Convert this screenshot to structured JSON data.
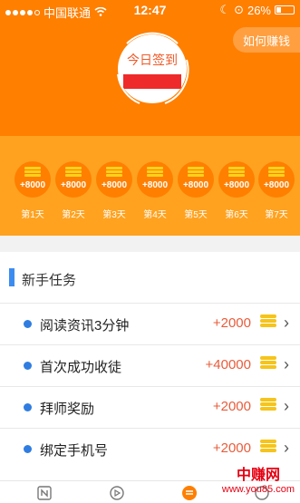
{
  "status_bar": {
    "carrier": "中国联通",
    "time": "12:47",
    "battery": "26%"
  },
  "header": {
    "how_earn_label": "如何赚钱",
    "signin_label": "今日签到",
    "accent_color": "#ff7f00"
  },
  "days": [
    {
      "label": "第1天",
      "reward": "+8000"
    },
    {
      "label": "第2天",
      "reward": "+8000"
    },
    {
      "label": "第3天",
      "reward": "+8000"
    },
    {
      "label": "第4天",
      "reward": "+8000"
    },
    {
      "label": "第5天",
      "reward": "+8000"
    },
    {
      "label": "第6天",
      "reward": "+8000"
    },
    {
      "label": "第7天",
      "reward": "+8000"
    }
  ],
  "tasks": {
    "title": "新手任务",
    "items": [
      {
        "name": "阅读资讯3分钟",
        "reward": "+2000"
      },
      {
        "name": "首次成功收徒",
        "reward": "+40000"
      },
      {
        "name": "拜师奖励",
        "reward": "+2000"
      },
      {
        "name": "绑定手机号",
        "reward": "+2000"
      }
    ]
  },
  "bottom_nav": {
    "icons": [
      "news-icon",
      "video-icon",
      "tasks-icon",
      "profile-icon"
    ]
  },
  "watermark": {
    "title": "中赚网",
    "url": "www.you85.com"
  }
}
